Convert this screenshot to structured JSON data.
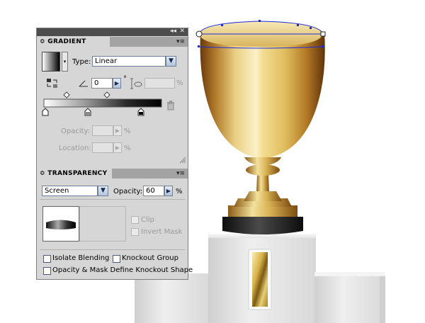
{
  "gradient_panel": {
    "double_arrow": "◂◂",
    "close": "✕",
    "tab_label": "GRADIENT",
    "tab_arrow": "≎",
    "menu_icon": "▾≡",
    "type_label": "Type:",
    "type_value": "Linear",
    "angle_value": "0",
    "degree_symbol": "°",
    "percent": "%",
    "opacity_label": "Opacity:",
    "location_label": "Location:"
  },
  "transparency_panel": {
    "tab_label": "TRANSPARENCY",
    "tab_arrow": "≎",
    "menu_icon": "▾≡",
    "blend_mode_value": "Screen",
    "opacity_label": "Opacity:",
    "opacity_value": "60",
    "percent": "%",
    "clip_label": "Clip",
    "invert_mask_label": "Invert Mask",
    "isolate_blending_label": "Isolate Blending",
    "knockout_group_label": "Knockout Group",
    "opacity_mask_knockout_label": "Opacity & Mask Define Knockout Shape"
  },
  "colors": {
    "panel_bg": "#d6d6d6",
    "panel_titlebar": "#4d4d4d",
    "selection_blue": "#1e2bd8",
    "gold_light": "#f2e4a6",
    "gold_dark": "#7a4a10",
    "pedestal": "#e9e9e9"
  }
}
